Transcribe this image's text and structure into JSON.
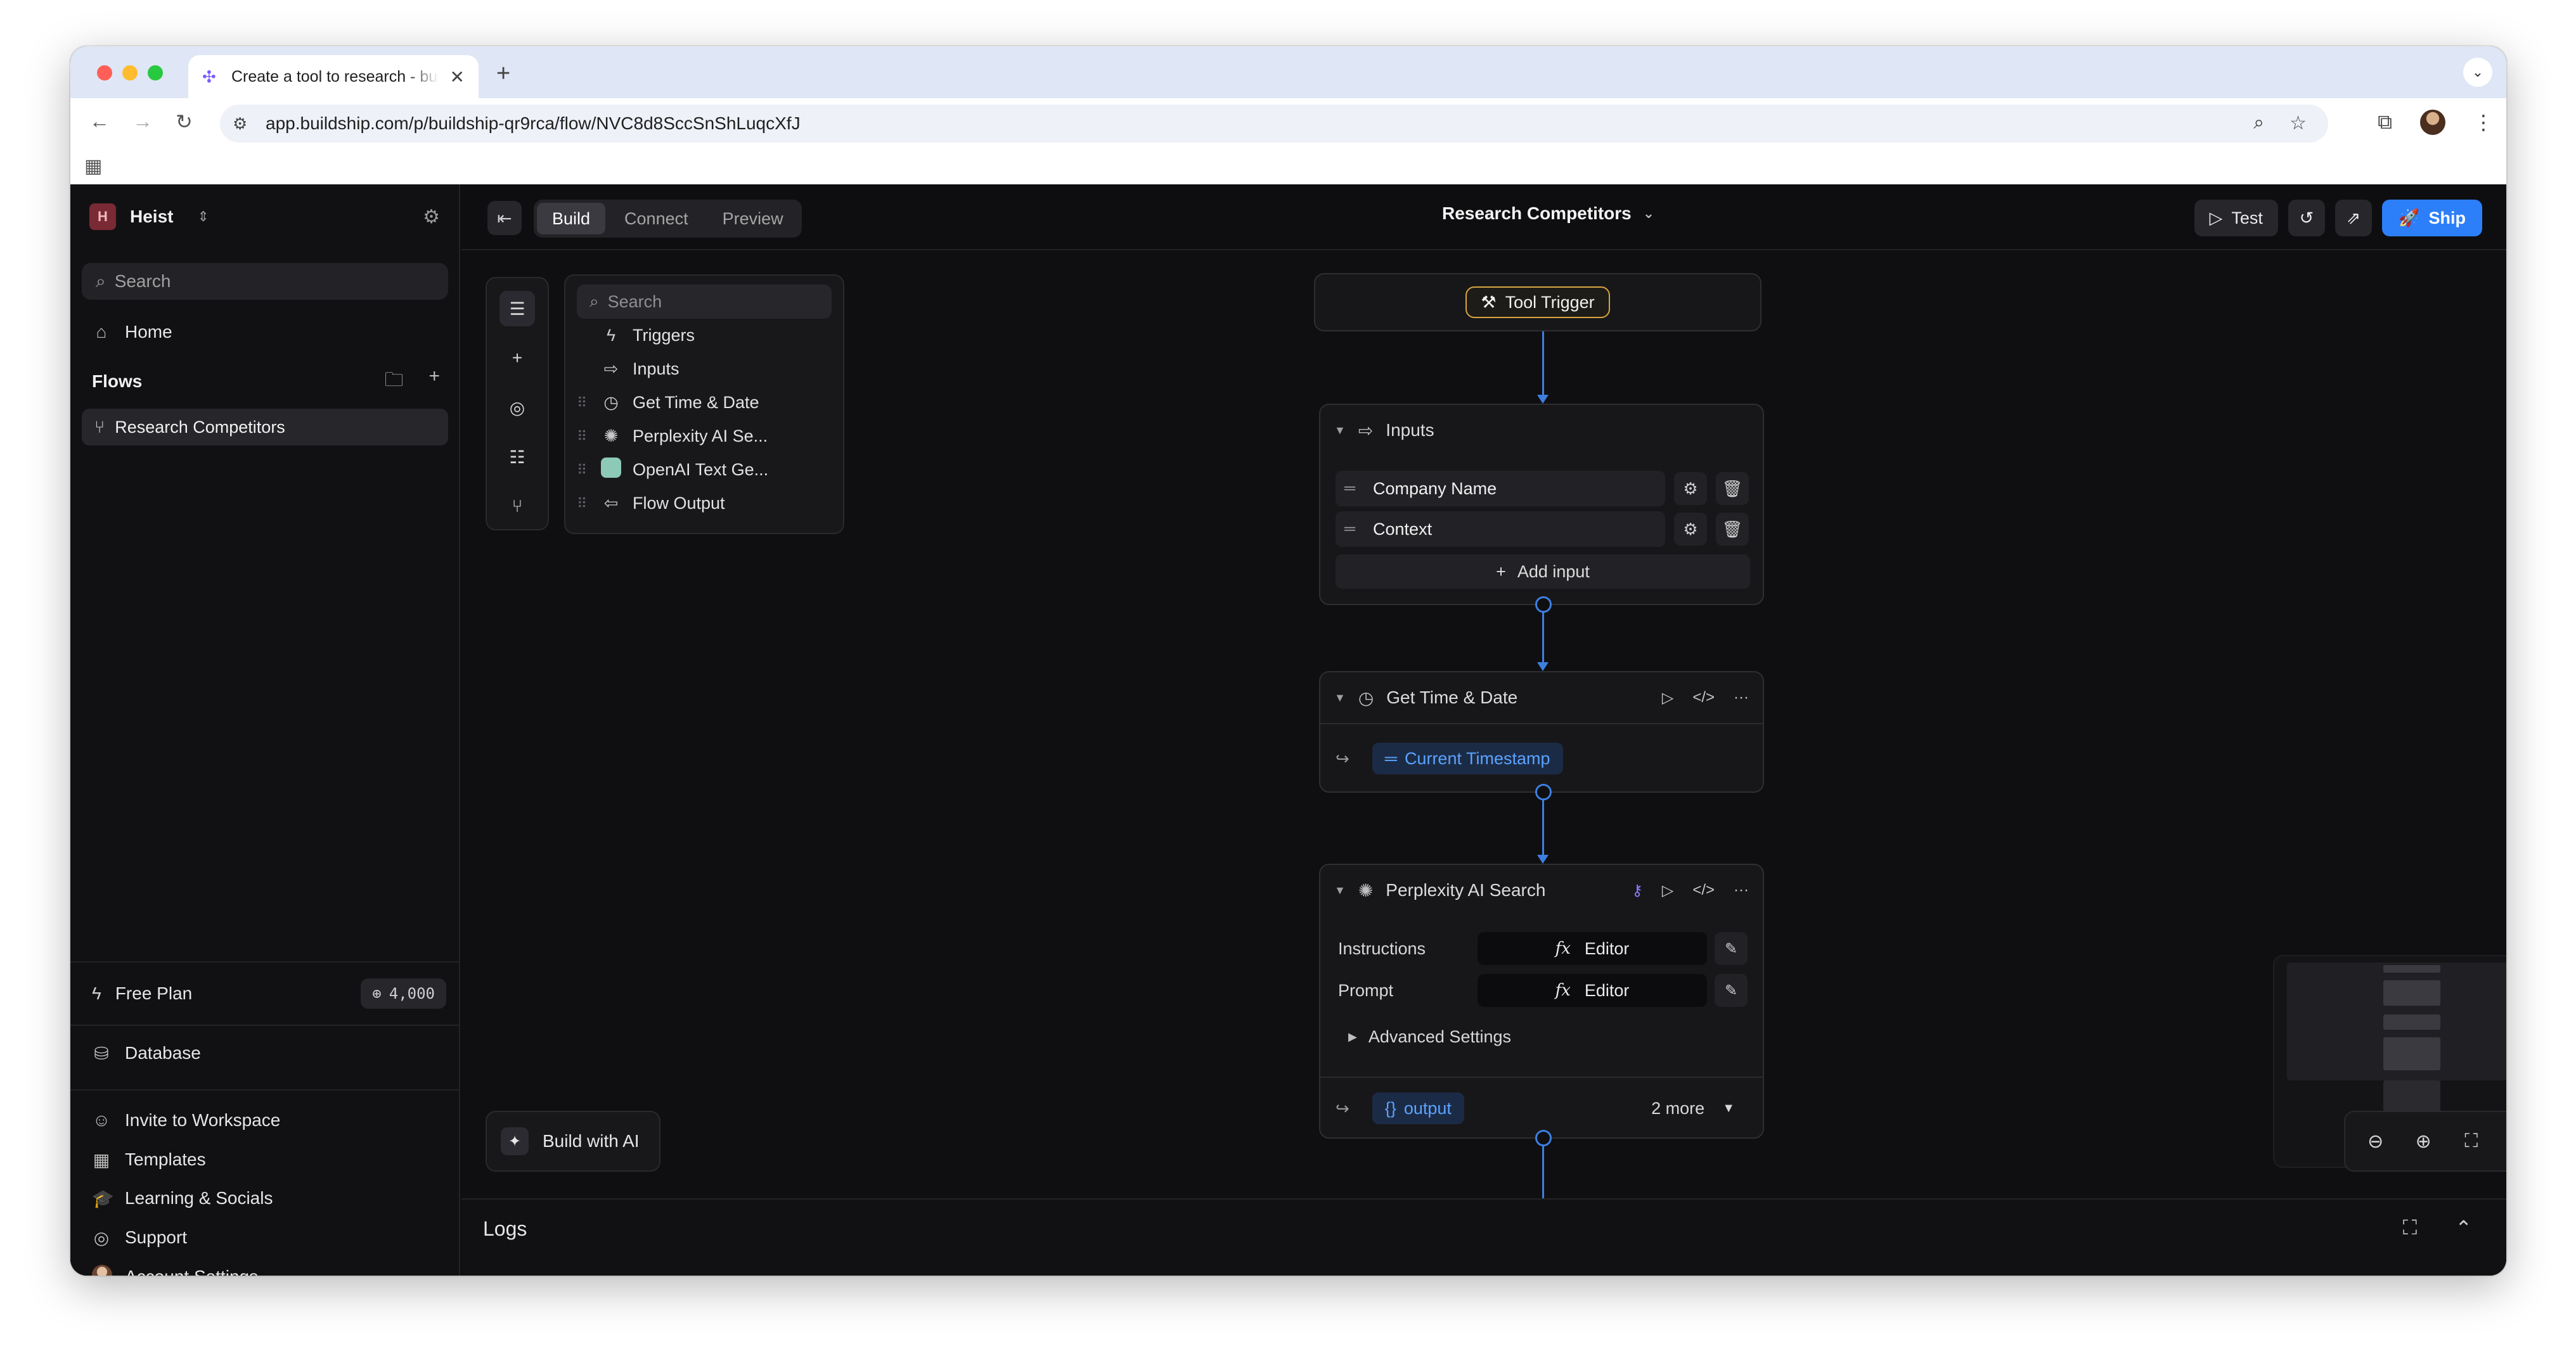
{
  "browser": {
    "tab_title": "Create a tool to research - buildship",
    "url": "app.buildship.com/p/buildship-qr9rca/flow/NVC8d8SccSnShLuqcXfJ"
  },
  "sidebar": {
    "workspace_initial": "H",
    "workspace_name": "Heist",
    "search_placeholder": "Search",
    "home_label": "Home",
    "flows_title": "Flows",
    "flows": [
      {
        "label": "Research Competitors"
      }
    ],
    "plan_label": "Free Plan",
    "credits": "4,000",
    "database_label": "Database",
    "bottom_items": [
      {
        "label": "Invite to Workspace",
        "icon": "user-plus-icon"
      },
      {
        "label": "Templates",
        "icon": "templates-icon"
      },
      {
        "label": "Learning & Socials",
        "icon": "graduation-cap-icon"
      },
      {
        "label": "Support",
        "icon": "lifebuoy-icon"
      },
      {
        "label": "Account Settings",
        "icon": "avatar"
      }
    ]
  },
  "topbar": {
    "modes": [
      "Build",
      "Connect",
      "Preview"
    ],
    "active_mode": "Build",
    "flow_title": "Research Competitors",
    "test_label": "Test",
    "ship_label": "Ship"
  },
  "steps_panel": {
    "search_placeholder": "Search",
    "items": [
      {
        "label": "Triggers",
        "icon": "bolt-icon"
      },
      {
        "label": "Inputs",
        "icon": "input-arrow-icon"
      },
      {
        "label": "Get Time & Date",
        "icon": "clock-icon"
      },
      {
        "label": "Perplexity AI Se...",
        "icon": "perplexity-icon"
      },
      {
        "label": "OpenAI Text Ge...",
        "icon": "openai-icon"
      },
      {
        "label": "Flow Output",
        "icon": "output-arrow-icon"
      }
    ]
  },
  "build_ai_label": "Build with AI",
  "nodes": {
    "trigger": {
      "label": "Tool Trigger"
    },
    "inputs": {
      "title": "Inputs",
      "fields": [
        "Company Name",
        "Context"
      ],
      "add_label": "Add input"
    },
    "time": {
      "title": "Get Time & Date",
      "output_chip": "Current Timestamp"
    },
    "perplexity": {
      "title": "Perplexity AI Search",
      "instructions_label": "Instructions",
      "prompt_label": "Prompt",
      "editor_label": "Editor",
      "advanced_label": "Advanced Settings",
      "output_chip": "output",
      "more_label": "2 more"
    }
  },
  "logs_title": "Logs",
  "colors": {
    "accent": "#2d7ff9",
    "connector": "#3d7fe0",
    "trigger_border": "#d8a440",
    "chip_text": "#5aa3ff"
  }
}
